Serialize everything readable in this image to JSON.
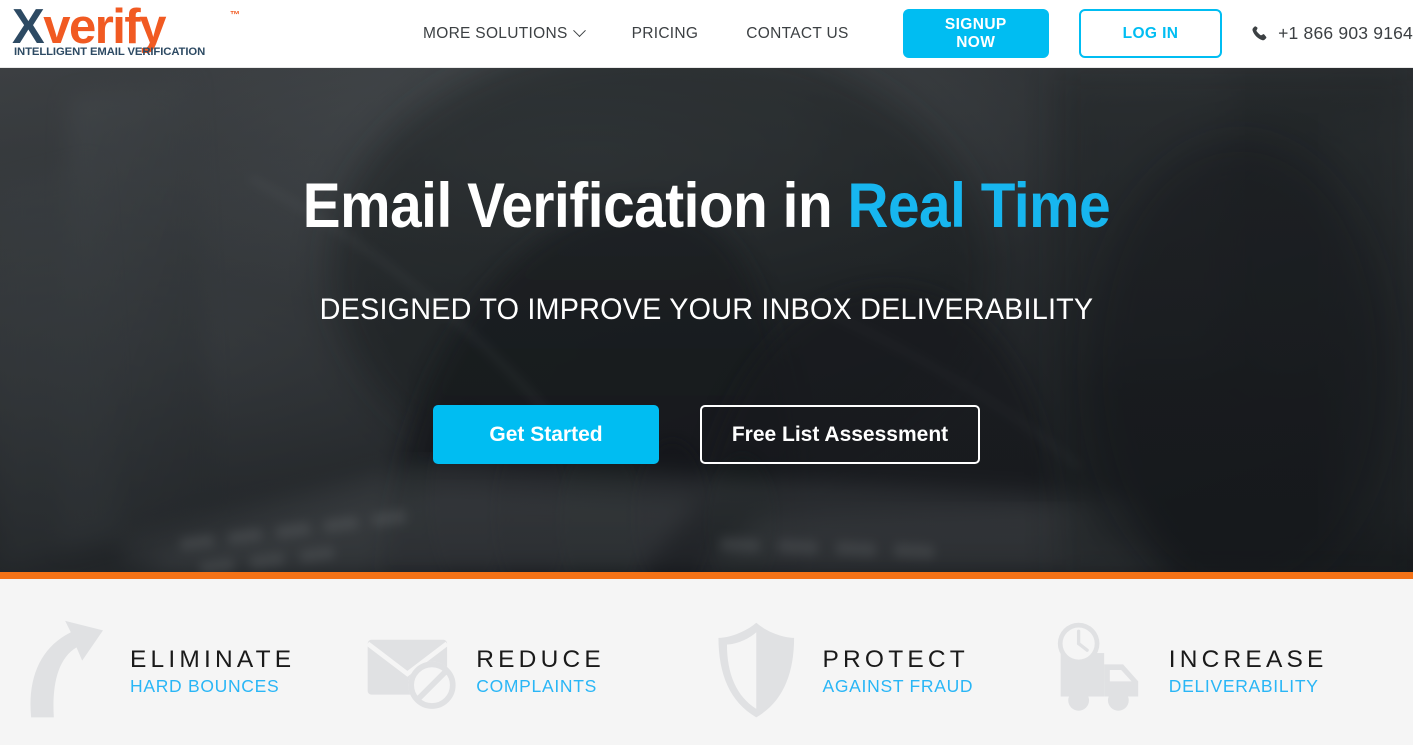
{
  "header": {
    "logo": {
      "x_text": "X",
      "verify_text": "verify",
      "trademark": "™",
      "tagline": "INTELLIGENT EMAIL VERIFICATION",
      "x_color": "#2d4a63",
      "verify_color": "#f15a22"
    },
    "nav": [
      {
        "label": "MORE SOLUTIONS",
        "has_dropdown": true
      },
      {
        "label": "PRICING",
        "has_dropdown": false
      },
      {
        "label": "CONTACT US",
        "has_dropdown": false
      }
    ],
    "signup_label": "SIGNUP NOW",
    "login_label": "LOG IN",
    "phone_number": "+1 866 903 9164",
    "accent_color": "#00bdf2"
  },
  "hero": {
    "title_main": "Email Verification in ",
    "title_accent": "Real Time",
    "subtitle": "DESIGNED TO IMPROVE YOUR INBOX DELIVERABILITY",
    "cta_primary": "Get Started",
    "cta_secondary": "Free List Assessment",
    "accent_color": "#17b6ef"
  },
  "divider": {
    "color": "#f47216"
  },
  "features": [
    {
      "icon": "curved-arrow-up-icon",
      "title": "ELIMINATE",
      "subtitle": "HARD BOUNCES"
    },
    {
      "icon": "envelope-blocked-icon",
      "title": "REDUCE",
      "subtitle": "COMPLAINTS"
    },
    {
      "icon": "shield-icon",
      "title": "PROTECT",
      "subtitle": "AGAINST FRAUD"
    },
    {
      "icon": "delivery-truck-clock-icon",
      "title": "INCREASE",
      "subtitle": "DELIVERABILITY"
    }
  ]
}
